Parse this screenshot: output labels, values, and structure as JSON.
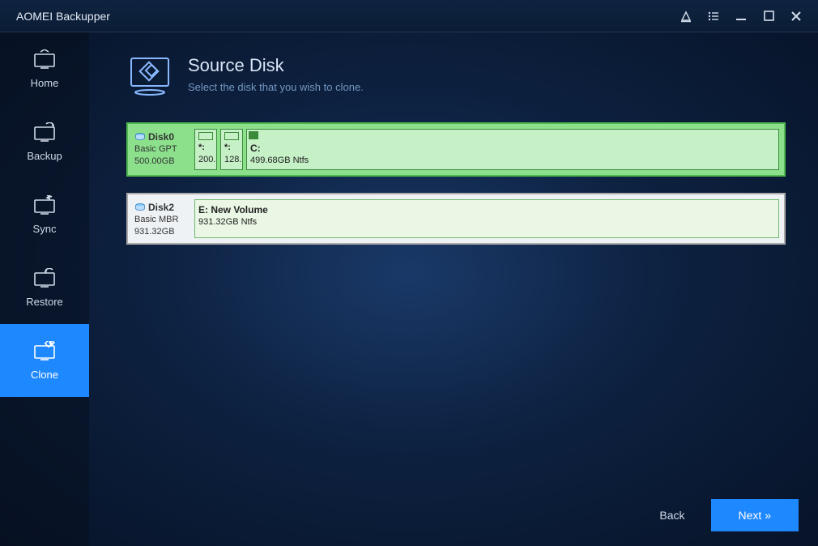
{
  "app": {
    "title": "AOMEI Backupper"
  },
  "sidebar": {
    "items": [
      {
        "label": "Home"
      },
      {
        "label": "Backup"
      },
      {
        "label": "Sync"
      },
      {
        "label": "Restore"
      },
      {
        "label": "Clone"
      }
    ]
  },
  "page": {
    "title": "Source Disk",
    "subtitle": "Select the disk that you wish to clone."
  },
  "disks": [
    {
      "name": "Disk0",
      "scheme": "Basic GPT",
      "size": "500.00GB",
      "selected": true,
      "partitions": [
        {
          "label": "*:",
          "detail": "200."
        },
        {
          "label": "*:",
          "detail": "128."
        },
        {
          "label": "C:",
          "detail": "499.68GB Ntfs"
        }
      ]
    },
    {
      "name": "Disk2",
      "scheme": "Basic MBR",
      "size": "931.32GB",
      "selected": false,
      "partitions": [
        {
          "label": "E: New Volume",
          "detail": "931.32GB Ntfs"
        }
      ]
    }
  ],
  "footer": {
    "back": "Back",
    "next": "Next »"
  }
}
